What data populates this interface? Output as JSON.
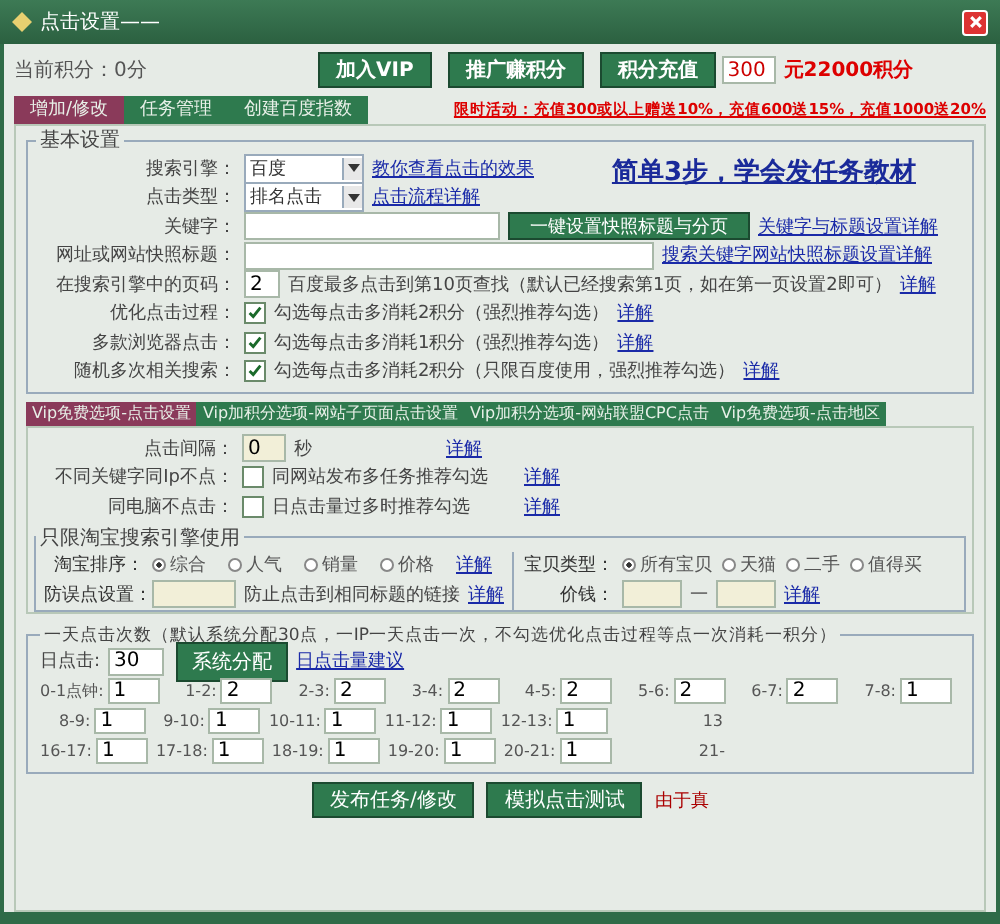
{
  "window": {
    "title": "点击设置——"
  },
  "header": {
    "points": "当前积分：0分",
    "buttons": [
      "加入VIP",
      "推广赚积分",
      "积分充值"
    ],
    "recharge_value": "300",
    "recharge_note": "元22000积分"
  },
  "tabs": [
    {
      "label": "增加/修改",
      "selected": true
    },
    {
      "label": "任务管理",
      "selected": false
    },
    {
      "label": "创建百度指数",
      "selected": false
    }
  ],
  "promo": "限时活动：充值300或以上赠送10%，充值600送15%，充值1000送20%",
  "basic": {
    "title": "基本设置",
    "tutorial_link": "简单3步，学会发任务教材",
    "rows": [
      {
        "kind": "select",
        "label": "搜索引擎：",
        "value": "百度",
        "link": "教你查看点击的效果"
      },
      {
        "kind": "select",
        "label": "点击类型：",
        "value": "排名点击",
        "link": "点击流程详解"
      },
      {
        "kind": "text",
        "label": "关键字：",
        "button": "一键设置快照标题与分页",
        "link": "关键字与标题设置详解"
      },
      {
        "kind": "wide",
        "label": "网址或网站快照标题：",
        "link": "搜索关键字网站快照标题设置详解"
      },
      {
        "kind": "page",
        "label": "在搜索引擎中的页码：",
        "value": "2",
        "note": "百度最多点击到第10页查找（默认已经搜索第1页，如在第一页设置2即可）",
        "link": "详解"
      },
      {
        "kind": "checkbox",
        "label": "优化点击过程：",
        "checked": true,
        "note": "勾选每点击多消耗2积分（强烈推荐勾选）",
        "link": "详解"
      },
      {
        "kind": "checkbox",
        "label": "多款浏览器点击：",
        "checked": true,
        "note": "勾选每点击多消耗1积分（强烈推荐勾选）",
        "link": "详解"
      },
      {
        "kind": "checkbox",
        "label": "随机多次相关搜索：",
        "checked": true,
        "note": "勾选每点击多消耗2积分（只限百度使用，强烈推荐勾选）",
        "link": "详解"
      }
    ]
  },
  "vip_tabs": [
    {
      "label": "Vip免费选项-点击设置",
      "selected": true
    },
    {
      "label": "Vip加积分选项-网站子页面点击设置",
      "selected": false
    },
    {
      "label": "Vip加积分选项-网站联盟CPC点击",
      "selected": false
    },
    {
      "label": "Vip免费选项-点击地区",
      "selected": false
    }
  ],
  "vip": {
    "rows": [
      {
        "kind": "seconds",
        "label": "点击间隔：",
        "value": "0",
        "unit": "秒",
        "link": "详解"
      },
      {
        "kind": "checkbox",
        "label": "不同关键字同Ip不点：",
        "checked": false,
        "note": "同网站发布多任务推荐勾选",
        "link": "详解"
      },
      {
        "kind": "checkbox",
        "label": "同电脑不点击：",
        "checked": false,
        "note": "日点击量过多时推荐勾选",
        "link": "详解"
      }
    ],
    "taobao": {
      "title": "只限淘宝搜索引擎使用",
      "sort_label": "淘宝排序：",
      "sort_options": [
        {
          "label": "综合",
          "selected": true
        },
        {
          "label": "人气",
          "selected": false
        },
        {
          "label": "销量",
          "selected": false
        },
        {
          "label": "价格",
          "selected": false
        }
      ],
      "sort_link": "详解",
      "guard_label": "防误点设置：",
      "guard_note": "防止点击到相同标题的链接",
      "guard_link": "详解",
      "type_label": "宝贝类型：",
      "type_options": [
        {
          "label": "所有宝贝",
          "selected": true
        },
        {
          "label": "天猫",
          "selected": false
        },
        {
          "label": "二手",
          "selected": false
        },
        {
          "label": "值得买",
          "selected": false
        }
      ],
      "price_label": "价钱：",
      "price_sep": "—",
      "price_link": "详解"
    }
  },
  "daily": {
    "title": "一天点击次数（默认系统分配30点，一IP一天点击一次，不勾选优化点击过程等点一次消耗一积分）",
    "label": "日点击:",
    "value": "30",
    "button": "系统分配",
    "link": "日点击量建议",
    "hours": [
      [
        {
          "label": "0-1点钟:",
          "value": "1"
        },
        {
          "label": "1-2:",
          "value": "2"
        },
        {
          "label": "2-3:",
          "value": "2"
        },
        {
          "label": "3-4:",
          "value": "2"
        },
        {
          "label": "4-5:",
          "value": "2"
        },
        {
          "label": "5-6:",
          "value": "2"
        },
        {
          "label": "6-7:",
          "value": "2"
        },
        {
          "label": "7-8:",
          "value": "1"
        }
      ],
      [
        {
          "label": "8-9:",
          "value": "1"
        },
        {
          "label": "9-10:",
          "value": "1"
        },
        {
          "label": "10-11:",
          "value": "1"
        },
        {
          "label": "11-12:",
          "value": "1"
        },
        {
          "label": "12-13:",
          "value": "1"
        },
        {
          "label": "13"
        }
      ],
      [
        {
          "label": "16-17:",
          "value": "1"
        },
        {
          "label": "17-18:",
          "value": "1"
        },
        {
          "label": "18-19:",
          "value": "1"
        },
        {
          "label": "19-20:",
          "value": "1"
        },
        {
          "label": "20-21:",
          "value": "1"
        },
        {
          "label": "21-"
        }
      ]
    ]
  },
  "footer": {
    "buttons": [
      "发布任务/修改",
      "模拟点击测试"
    ],
    "note": "由于真"
  }
}
